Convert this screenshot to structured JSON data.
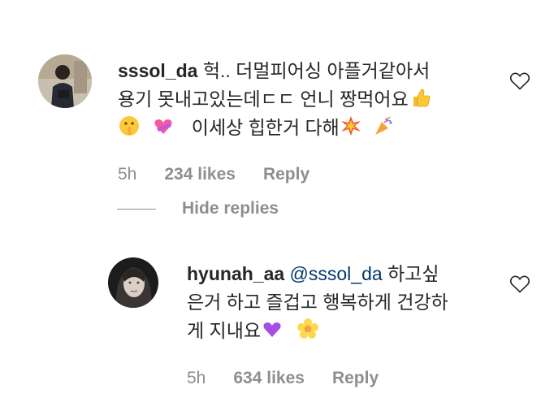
{
  "comments": [
    {
      "username": "sssol_da",
      "line1": "헉.. 더멀피어싱 아플거같아서",
      "line2": "용기 못내고있는데ㄷㄷ 언니 짱먹어요",
      "line3": "이세상 힙한거 다해",
      "meta": {
        "time": "5h",
        "likes": "234 likes",
        "reply": "Reply"
      }
    }
  ],
  "hide_replies_label": "Hide replies",
  "reply": {
    "username": "hyunah_aa",
    "mention": "@sssol_da",
    "line1_rest": "하고싶",
    "line2": "은거 하고 즐겁고 행복하게 건강하",
    "line3": "게 지내요",
    "meta": {
      "time": "5h",
      "likes": "634 likes",
      "reply": "Reply"
    }
  },
  "icons": {
    "like": "heart-outline-icon",
    "emoji_a": "thumbs-up-emoji",
    "emoji_b": "shushing-face-emoji",
    "emoji_c": "heart-with-ribbon-emoji",
    "emoji_d": "collision-emoji",
    "emoji_e": "party-popper-emoji",
    "emoji_f": "purple-heart-emoji",
    "emoji_g": "blossom-emoji"
  }
}
